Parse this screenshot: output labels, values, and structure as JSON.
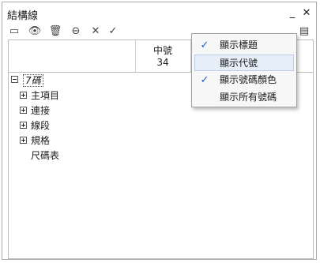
{
  "window": {
    "title": "結構線",
    "minimize_glyph": "_",
    "close_glyph": "✕"
  },
  "toolbar": {
    "buttons": [
      {
        "icon": "list-view-icon",
        "glyph": "▭"
      },
      {
        "icon": "eye-icon",
        "glyph": "👁"
      },
      {
        "icon": "trash-icon",
        "glyph": "🗑"
      },
      {
        "icon": "link-icon",
        "glyph": "⊖"
      },
      {
        "icon": "close-icon",
        "glyph": "✕"
      },
      {
        "icon": "check-icon",
        "glyph": "✓"
      }
    ],
    "options_glyph": "▤"
  },
  "grid": {
    "column_header_line1": "中號",
    "column_header_line2": "34"
  },
  "tree": {
    "root": "7碼",
    "children": [
      "主項目",
      "連接",
      "線段",
      "規格",
      "尺碼表"
    ]
  },
  "menu": {
    "items": [
      {
        "label": "顯示標題",
        "checked": true
      },
      {
        "label": "顯示代號",
        "checked": false
      },
      {
        "label": "顯示號碼顏色",
        "checked": true
      },
      {
        "label": "顯示所有號碼",
        "checked": false
      }
    ],
    "check_glyph": "✓"
  },
  "colors": {
    "accent": "#1f5fbf",
    "menu_hover": "#e5eef9"
  }
}
